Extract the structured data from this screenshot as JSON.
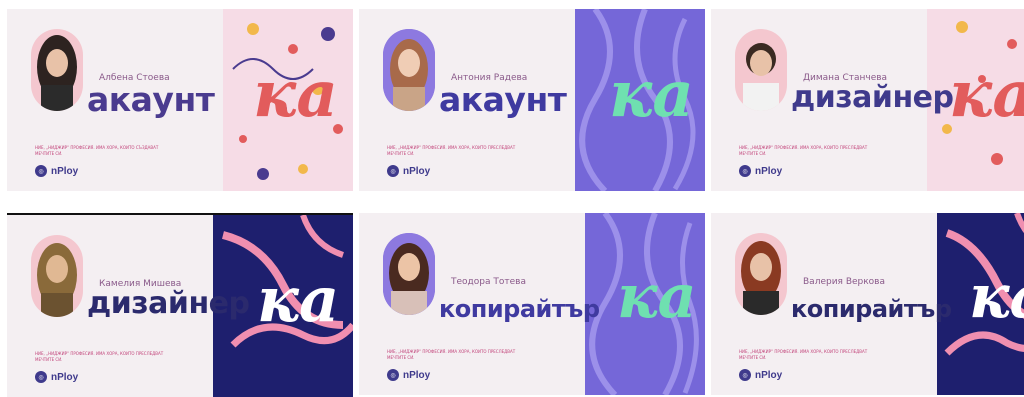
{
  "cards": [
    {
      "name": "Албена Стоева",
      "role": "акаунт",
      "ka": "ка",
      "tag": "НИЕ, „НИДЖИР“ ПРОФЕСИЯ. ИМА ХОРА, КОИТО СЪЗДАВАТ МЕЧТИТЕ СИ.",
      "logo": "nPloy",
      "colors": {
        "role": "#4a3b8f",
        "ka": "#e25c5c",
        "deco": "#f6dce6",
        "portrait": "#f4c7cf"
      }
    },
    {
      "name": "Антония Радева",
      "role": "акаунт",
      "ka": "ка",
      "tag": "НИЕ, „НИДЖИР“ ПРОФЕСИЯ. ИМА ХОРА, КОИТО ПРЕСЛЕДВАТ МЕЧТИТЕ СИ.",
      "logo": "nPloy",
      "colors": {
        "role": "#3f3aa0",
        "ka": "#6fe0b0",
        "deco": "#7567d8",
        "portrait": "#8d79e0"
      }
    },
    {
      "name": "Димана Станчева",
      "role": "дизайнер",
      "ka": "ка",
      "tag": "НИЕ, „НИДЖИР“ ПРОФЕСИЯ. ИМА ХОРА, КОИТО ПРЕСЛЕДВАТ МЕЧТИТЕ СИ.",
      "logo": "nPloy",
      "colors": {
        "role": "#3f3a8c",
        "ka": "#e25c5c",
        "deco": "#f6dce6",
        "portrait": "#f4c7cf"
      }
    },
    {
      "name": "Камелия Мишева",
      "role": "дизайнер",
      "ka": "ка",
      "tag": "НИЕ, „НИДЖИР“ ПРОФЕСИЯ. ИМА ХОРА, КОИТО ПРЕСЛЕДВАТ МЕЧТИТЕ СИ.",
      "logo": "nPloy",
      "colors": {
        "role": "#2b2a6d",
        "ka": "#ffffff",
        "deco": "#1e1f6e",
        "portrait": "#f4c7cf"
      }
    },
    {
      "name": "Теодора Тотева",
      "role": "копирайтър",
      "ka": "ка",
      "tag": "НИЕ, „НИДЖИР“ ПРОФЕСИЯ. ИМА ХОРА, КОИТО ПРЕСЛЕДВАТ МЕЧТИТЕ СИ.",
      "logo": "nPloy",
      "colors": {
        "role": "#3f3aa0",
        "ka": "#6fe0b0",
        "deco": "#7567d8",
        "portrait": "#8d79e0"
      }
    },
    {
      "name": "Валерия Веркова",
      "role": "копирайтър",
      "ka": "ка",
      "tag": "НИЕ, „НИДЖИР“ ПРОФЕСИЯ. ИМА ХОРА, КОИТО ПРЕСЛЕДВАТ МЕЧТИТЕ СИ.",
      "logo": "nPloy",
      "colors": {
        "role": "#2b2a6d",
        "ka": "#ffffff",
        "deco": "#1e1f6e",
        "portrait": "#f4c7cf"
      }
    }
  ]
}
